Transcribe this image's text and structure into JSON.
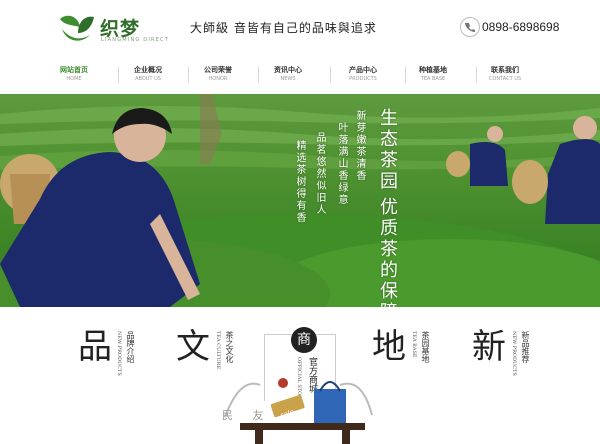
{
  "header": {
    "logo_name": "织梦",
    "logo_sub": "LIANGMING DIRECT",
    "slogan": "大師級 音皆有自己的品味與追求",
    "phone": "0898-6898698"
  },
  "nav": [
    {
      "zh": "网站首页",
      "en": "HOME",
      "active": true
    },
    {
      "zh": "企业概况",
      "en": "ABOUT US"
    },
    {
      "zh": "公司荣誉",
      "en": "HONOR"
    },
    {
      "zh": "资讯中心",
      "en": "NEWS"
    },
    {
      "zh": "产品中心",
      "en": "PRODUCTS"
    },
    {
      "zh": "种植基地",
      "en": "TEA BASE"
    },
    {
      "zh": "联系我们",
      "en": "CONTACT US"
    }
  ],
  "banner": {
    "headline_1": "生态茶园",
    "headline_2": "优质茶的保障",
    "poem_1": "新芽嫩茶清香",
    "poem_2": "叶落满山香绿意",
    "poem_3": "品茗悠然似旧人",
    "poem_4": "精选茶树得有香"
  },
  "sections": [
    {
      "big": "品",
      "zh": "品牌介绍",
      "en": "NEW PRODUCTS"
    },
    {
      "big": "文",
      "zh": "茶之文化",
      "en": "TEA CULTURE"
    },
    {
      "big": "地",
      "zh": "茶园基地",
      "en": "TEA BASE"
    },
    {
      "big": "新",
      "zh": "新品推荐",
      "en": "NEW PRODUCTS"
    }
  ],
  "center": {
    "badge": "商",
    "title": "官方商城",
    "en": "OFFICIAL STORE",
    "bottom_left": "民 友",
    "sale": "sale"
  },
  "colors": {
    "brand": "#2f6d2a",
    "accent": "#3e8e2f"
  }
}
